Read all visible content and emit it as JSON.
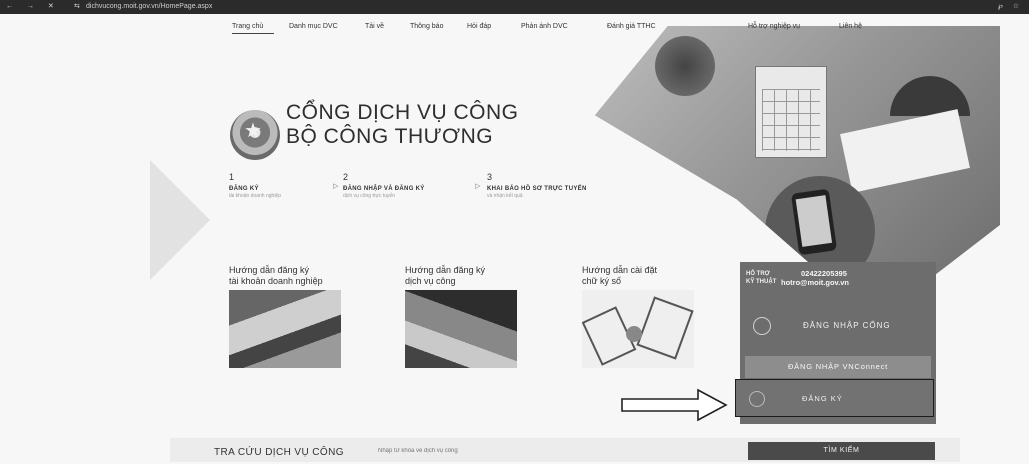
{
  "browser": {
    "url": "dichvucong.moit.gov.vn/HomePage.aspx",
    "nav_glyphs": "← → ✕",
    "lock_glyph": "⇆",
    "right_glyphs": "℘ ☆"
  },
  "menu": {
    "items": [
      "Trang chủ",
      "Danh mục DVC",
      "Tải về",
      "Thông báo",
      "Hỏi đáp",
      "Phản ánh DVC",
      "Đánh giá TTHC",
      "Hỗ trợ nghiệp vụ",
      "Liên hệ"
    ],
    "active": "Trang chủ"
  },
  "header": {
    "title_line1": "CỔNG DỊCH VỤ CÔNG",
    "title_line2": "BỘ CÔNG THƯƠNG"
  },
  "steps": [
    {
      "num": "1",
      "label": "ĐĂNG KÝ",
      "sub": "tài khoản doanh nghiệp"
    },
    {
      "num": "2",
      "label": "ĐĂNG NHẬP VÀ ĐĂNG KÝ",
      "sub": "dịch vụ công trực tuyến"
    },
    {
      "num": "3",
      "label": "KHAI BÁO HỒ SƠ TRỰC TUYẾN",
      "sub": "và nhận kết quả"
    }
  ],
  "guides": [
    {
      "line1": "Hướng dẫn đăng ký",
      "line2": "tài khoản doanh nghiệp"
    },
    {
      "line1": "Hướng dẫn đăng ký",
      "line2": "dịch vụ công"
    },
    {
      "line1": "Hướng dẫn cài đặt",
      "line2": "chữ ký số"
    }
  ],
  "login_panel": {
    "support_label_1": "HỖ TRỢ",
    "support_label_2": "KỸ THUẬT",
    "phone": "02422205395",
    "email": "hotro@moit.gov.vn",
    "login_button": "ĐĂNG NHẬP CỔNG",
    "vconnect_button": "ĐĂNG NHẬP VNConnect",
    "register_button": "ĐĂNG KÝ"
  },
  "search": {
    "title": "TRA CỨU DỊCH VỤ CÔNG",
    "placeholder": "Nhập từ khóa về dịch vụ công",
    "button": "TÌM KIẾM"
  },
  "colors": {
    "panel": "#6d6d6d",
    "search_button": "#4a4a4a"
  }
}
